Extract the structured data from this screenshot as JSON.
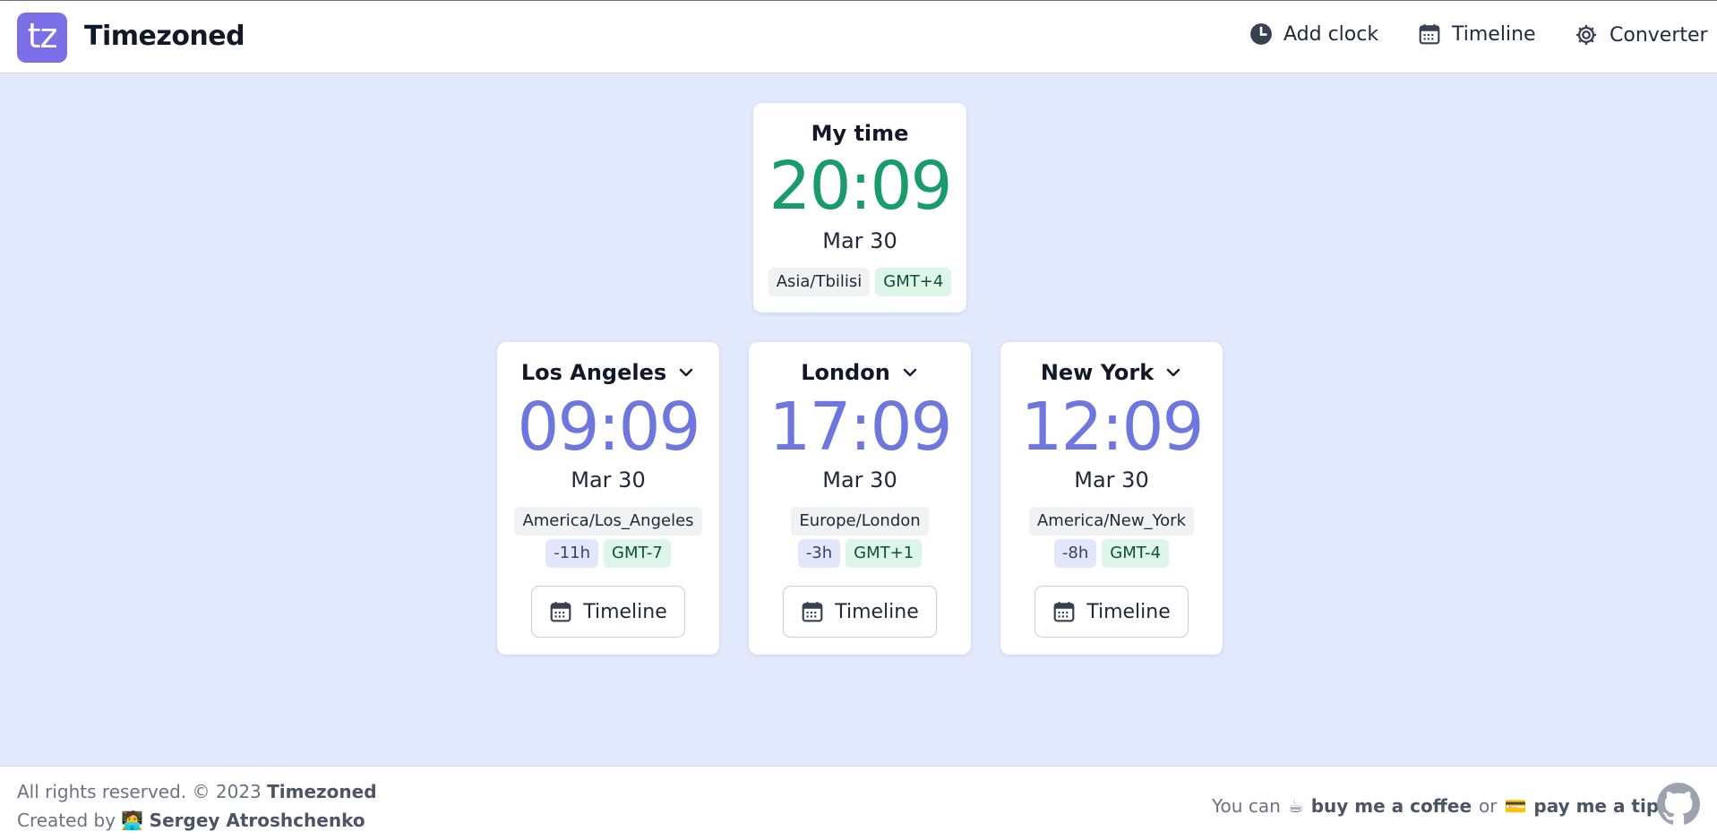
{
  "header": {
    "logo_text": "tz",
    "brand": "Timezoned",
    "nav": {
      "add_clock": "Add clock",
      "timeline": "Timeline",
      "converter": "Converter"
    }
  },
  "my_time": {
    "title": "My time",
    "time": "20:09",
    "date": "Mar 30",
    "zone": "Asia/Tbilisi",
    "gmt": "GMT+4",
    "time_color": "#1a9b6c"
  },
  "clocks": [
    {
      "city": "Los Angeles",
      "time": "09:09",
      "date": "Mar 30",
      "zone": "America/Los_Angeles",
      "diff": "-11h",
      "gmt": "GMT-7",
      "button": "Timeline"
    },
    {
      "city": "London",
      "time": "17:09",
      "date": "Mar 30",
      "zone": "Europe/London",
      "diff": "-3h",
      "gmt": "GMT+1",
      "button": "Timeline"
    },
    {
      "city": "New York",
      "time": "12:09",
      "date": "Mar 30",
      "zone": "America/New_York",
      "diff": "-8h",
      "gmt": "GMT-4",
      "button": "Timeline"
    }
  ],
  "footer": {
    "rights": "All rights reserved. © 2023",
    "brand": "Timezoned",
    "created_by": "Created by",
    "author_emoji": "🧑‍💻",
    "author": "Sergey Atroshchenko",
    "you_can": "You can",
    "coffee_emoji": "☕",
    "coffee": "buy me a coffee",
    "or": "or",
    "tip_emoji": "💳",
    "tip": "pay me a tip"
  },
  "colors": {
    "background": "#e3e9fc",
    "accent": "#7b6ee6",
    "city_time": "#6e77dd",
    "my_time": "#1a9b6c"
  },
  "icons": [
    "clock-icon",
    "calendar-icon",
    "gear-icon",
    "chevron-down-icon",
    "github-icon"
  ]
}
